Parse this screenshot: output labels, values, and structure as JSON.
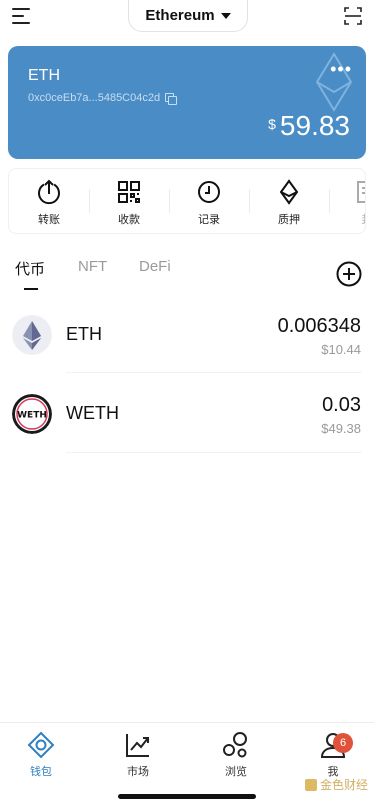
{
  "header": {
    "network": "Ethereum"
  },
  "wallet": {
    "chain": "ETH",
    "address": "0xc0ceEb7a...5485C04c2d",
    "currency_symbol": "$",
    "balance": "59.83",
    "colors": {
      "card": "#4a8dc6"
    }
  },
  "actions": [
    {
      "label": "转账",
      "icon": "transfer-icon"
    },
    {
      "label": "收款",
      "icon": "qr-receive-icon"
    },
    {
      "label": "记录",
      "icon": "history-icon"
    },
    {
      "label": "质押",
      "icon": "stake-icon"
    },
    {
      "label": "封",
      "icon": "more-action-icon"
    }
  ],
  "tabs": [
    {
      "label": "代币",
      "active": true
    },
    {
      "label": "NFT",
      "active": false
    },
    {
      "label": "DeFi",
      "active": false
    }
  ],
  "tokens": [
    {
      "symbol": "ETH",
      "quantity": "0.006348",
      "fiat": "$10.44",
      "icon": "eth-logo-icon"
    },
    {
      "symbol": "WETH",
      "quantity": "0.03",
      "fiat": "$49.38",
      "icon": "weth-logo-icon"
    }
  ],
  "bottom_nav": [
    {
      "label": "钱包",
      "icon": "wallet-icon",
      "active": true
    },
    {
      "label": "市场",
      "icon": "market-icon",
      "active": false
    },
    {
      "label": "浏览",
      "icon": "browse-icon",
      "active": false
    },
    {
      "label": "我",
      "icon": "profile-icon",
      "active": false,
      "badge": "6"
    }
  ],
  "watermark": "金色财经",
  "colors": {
    "accent": "#2f7fc1",
    "badge": "#e0533b"
  }
}
